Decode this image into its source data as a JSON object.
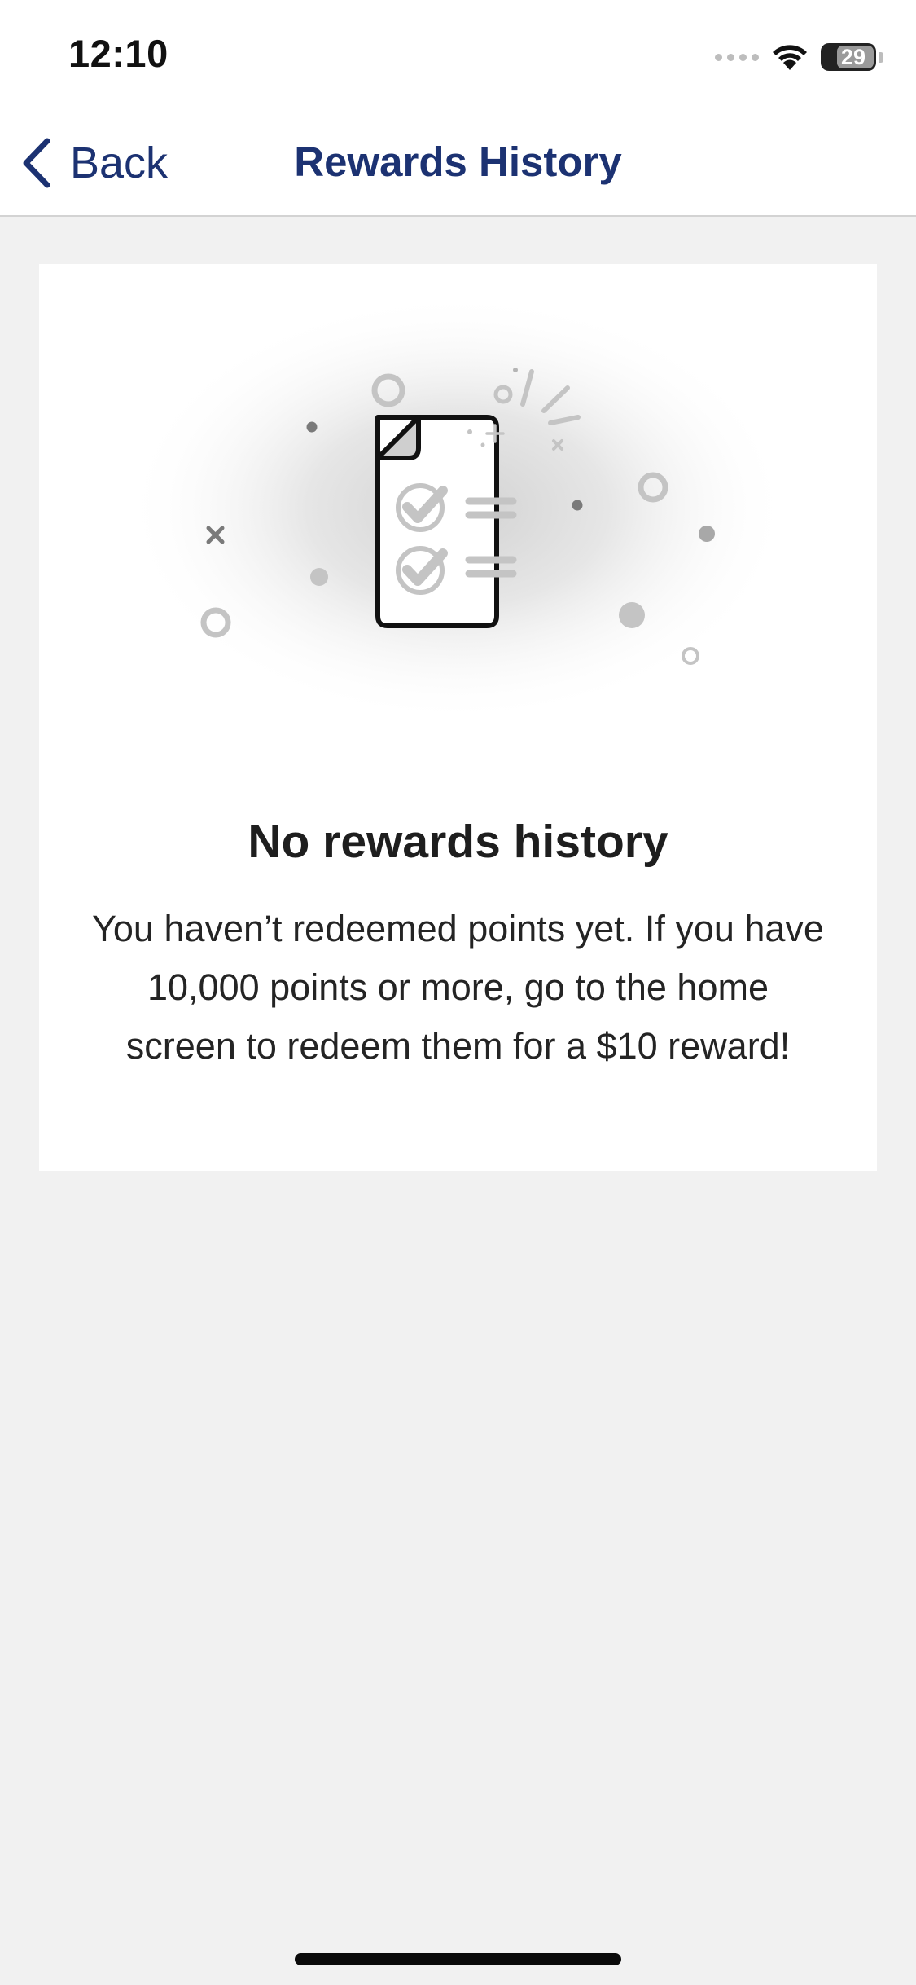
{
  "status_bar": {
    "time": "12:10",
    "battery_level": "29",
    "icons": [
      "cellular-signal-icon",
      "wifi-icon",
      "battery-icon"
    ]
  },
  "nav": {
    "back_label": "Back",
    "title": "Rewards History",
    "back_icon": "chevron-left-icon"
  },
  "empty_state": {
    "illustration_icon": "checklist-document-icon",
    "title": "No rewards history",
    "message": "You haven’t redeemed points yet. If you have 10,000 points or more, go to the home screen to redeem them for a $10 reward!"
  },
  "colors": {
    "brand": "#1c3272",
    "background": "#f1f1f1",
    "card": "#ffffff",
    "text": "#1e1e1e"
  }
}
